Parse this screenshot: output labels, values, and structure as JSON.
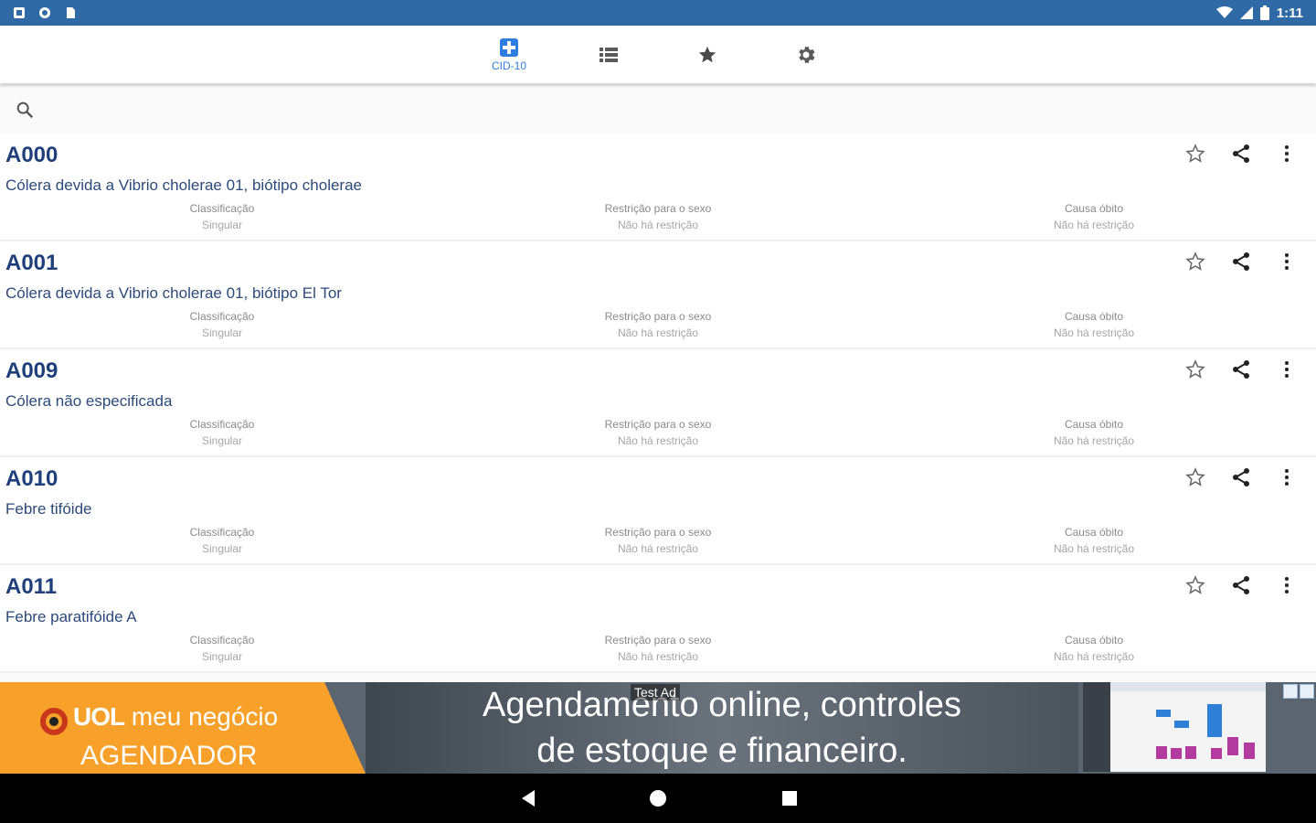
{
  "status": {
    "time": "1:11"
  },
  "tabs": [
    {
      "name": "cid10",
      "label": "CID-10",
      "icon": "medical-cross-icon",
      "active": true
    },
    {
      "name": "list",
      "label": "",
      "icon": "list-icon",
      "active": false
    },
    {
      "name": "favorites",
      "label": "",
      "icon": "star-icon",
      "active": false
    },
    {
      "name": "settings",
      "label": "",
      "icon": "gear-icon",
      "active": false
    }
  ],
  "search": {
    "placeholder": ""
  },
  "items": [
    {
      "code": "A000",
      "desc": "Cólera devida a Vibrio cholerae 01, biótipo cholerae",
      "c_label": "Classificação",
      "c_value": "Singular",
      "s_label": "Restrição para o sexo",
      "s_value": "Não há restrição",
      "o_label": "Causa óbito",
      "o_value": "Não há restrição"
    },
    {
      "code": "A001",
      "desc": "Cólera devida a Vibrio cholerae 01, biótipo El Tor",
      "c_label": "Classificação",
      "c_value": "Singular",
      "s_label": "Restrição para o sexo",
      "s_value": "Não há restrição",
      "o_label": "Causa óbito",
      "o_value": "Não há restrição"
    },
    {
      "code": "A009",
      "desc": "Cólera não especificada",
      "c_label": "Classificação",
      "c_value": "Singular",
      "s_label": "Restrição para o sexo",
      "s_value": "Não há restrição",
      "o_label": "Causa óbito",
      "o_value": "Não há restrição"
    },
    {
      "code": "A010",
      "desc": "Febre tifóide",
      "c_label": "Classificação",
      "c_value": "Singular",
      "s_label": "Restrição para o sexo",
      "s_value": "Não há restrição",
      "o_label": "Causa óbito",
      "o_value": "Não há restrição"
    },
    {
      "code": "A011",
      "desc": "Febre paratifóide A",
      "c_label": "Classificação",
      "c_value": "Singular",
      "s_label": "Restrição para o sexo",
      "s_value": "Não há restrição",
      "o_label": "Causa óbito",
      "o_value": "Não há restrição"
    }
  ],
  "ad": {
    "brand_uol": "UOL",
    "brand_rest": "meu negócio",
    "brand_sub": "AGENDADOR",
    "headline_1": "Agendamento online, controles",
    "headline_2": "de estoque e financeiro.",
    "tag": "Test Ad"
  },
  "colors": {
    "status_bar": "#2f6aa6",
    "accent": "#2f7de0",
    "code_text": "#1f3f7a",
    "ad_orange": "#f7a12b"
  }
}
